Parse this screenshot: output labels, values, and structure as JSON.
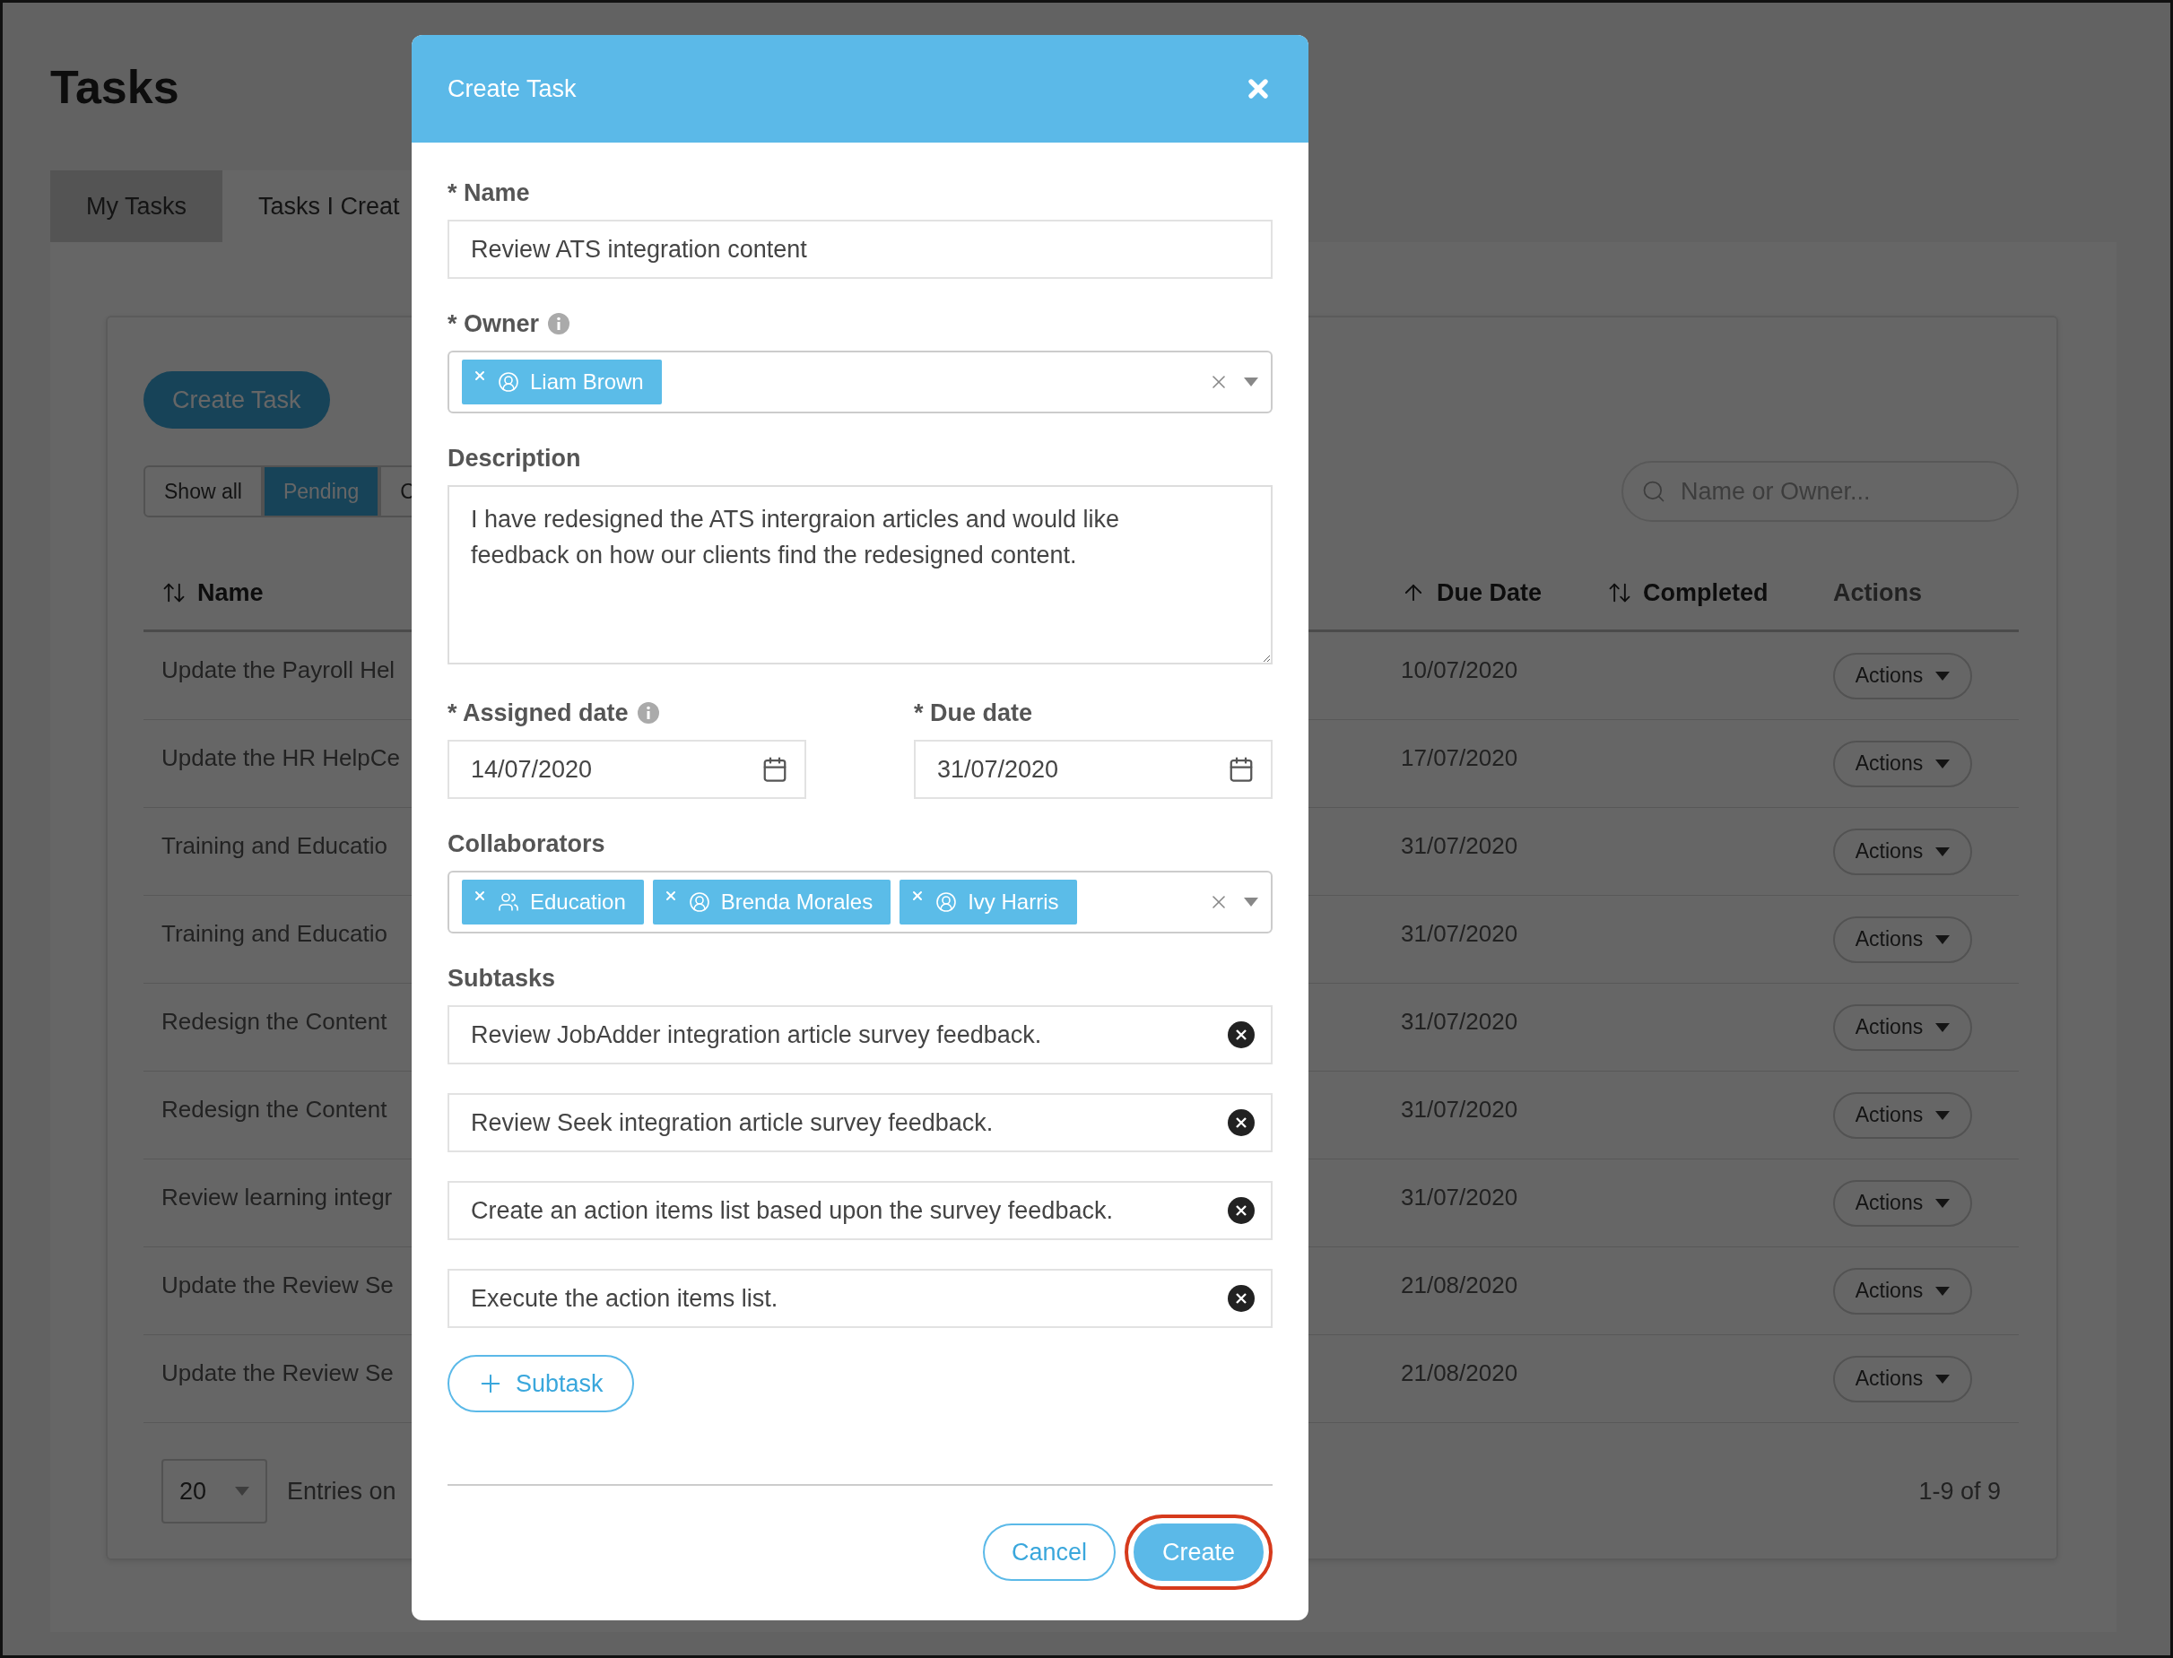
{
  "page": {
    "title": "Tasks"
  },
  "tabs": [
    {
      "label": "My Tasks",
      "selected": false
    },
    {
      "label": "Tasks I Creat",
      "selected": true
    }
  ],
  "create_button": "Create Task",
  "filters": [
    {
      "label": "Show all",
      "selected": false
    },
    {
      "label": "Pending",
      "selected": true
    },
    {
      "label": "C",
      "selected": false
    }
  ],
  "search": {
    "placeholder": "Name or Owner..."
  },
  "table": {
    "columns": [
      {
        "label": "Name",
        "kind": "sortable"
      },
      {
        "label": "Due Date",
        "kind": "ascending"
      },
      {
        "label": "Completed",
        "kind": "sortable"
      },
      {
        "label": "Actions",
        "kind": "plain"
      }
    ],
    "rows": [
      {
        "name": "Update the Payroll Hel",
        "due_date": "10/07/2020",
        "action": "Actions"
      },
      {
        "name": "Update the HR HelpCe",
        "due_date": "17/07/2020",
        "action": "Actions"
      },
      {
        "name": "Training and Educatio",
        "due_date": "31/07/2020",
        "action": "Actions"
      },
      {
        "name": "Training and Educatio",
        "due_date": "31/07/2020",
        "action": "Actions"
      },
      {
        "name": "Redesign the Content",
        "due_date": "31/07/2020",
        "action": "Actions"
      },
      {
        "name": "Redesign the Content",
        "due_date": "31/07/2020",
        "action": "Actions"
      },
      {
        "name": "Review learning integr",
        "due_date": "31/07/2020",
        "action": "Actions"
      },
      {
        "name": "Update the Review Se",
        "due_date": "21/08/2020",
        "action": "Actions"
      },
      {
        "name": "Update the Review Se",
        "due_date": "21/08/2020",
        "action": "Actions"
      }
    ]
  },
  "footer": {
    "page_size": "20",
    "entries_label": "Entries on",
    "range": "1-9 of 9"
  },
  "modal": {
    "title": "Create Task",
    "name": {
      "label": "* Name",
      "value": "Review ATS integration content"
    },
    "owner": {
      "label": "* Owner",
      "info": true,
      "chips": [
        {
          "kind": "person",
          "label": "Liam Brown"
        }
      ]
    },
    "description": {
      "label": "Description",
      "value": "I have redesigned the ATS intergraion articles and would like feedback on how our clients find the redesigned content."
    },
    "assigned_date": {
      "label": "* Assigned date",
      "info": true,
      "value": "14/07/2020"
    },
    "due_date": {
      "label": "* Due date",
      "info": false,
      "value": "31/07/2020"
    },
    "collaborators": {
      "label": "Collaborators",
      "chips": [
        {
          "kind": "group",
          "label": "Education"
        },
        {
          "kind": "person",
          "label": "Brenda Morales"
        },
        {
          "kind": "person",
          "label": "Ivy Harris"
        }
      ]
    },
    "subtasks": {
      "label": "Subtasks",
      "items": [
        "Review JobAdder integration article survey feedback.",
        "Review Seek integration article survey feedback.",
        "Create an action items list based upon the survey feedback.",
        "Execute the action items list."
      ],
      "add_button": "Subtask"
    },
    "buttons": [
      {
        "kind": "cancel",
        "label": "Cancel",
        "highlighted": false
      },
      {
        "kind": "create",
        "label": "Create",
        "highlighted": true
      }
    ]
  }
}
